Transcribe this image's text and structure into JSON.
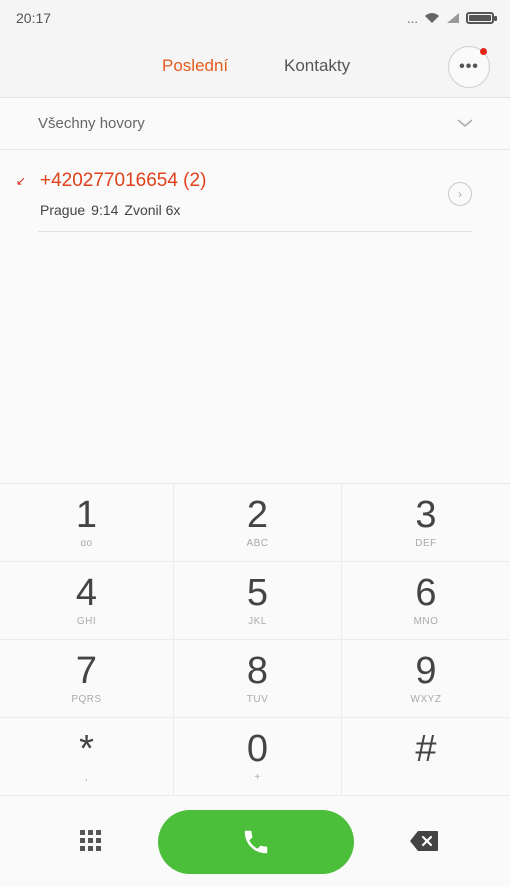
{
  "status_bar": {
    "time": "20:17",
    "signal_text": "..."
  },
  "header": {
    "tabs": [
      {
        "label": "Poslední",
        "active": true
      },
      {
        "label": "Kontakty",
        "active": false
      }
    ],
    "menu_icon": "more-icon",
    "notification_color": "#e0261b"
  },
  "filter": {
    "label": "Všechny hovory",
    "icon": "chevron-down-icon"
  },
  "calls": [
    {
      "number": "+420277016654 (2)",
      "location": "Prague",
      "time": "9:14",
      "status": "Zvonil 6x",
      "type": "missed"
    }
  ],
  "keypad": [
    {
      "digit": "1",
      "letters": "ɑo"
    },
    {
      "digit": "2",
      "letters": "ABC"
    },
    {
      "digit": "3",
      "letters": "DEF"
    },
    {
      "digit": "4",
      "letters": "GHI"
    },
    {
      "digit": "5",
      "letters": "JKL"
    },
    {
      "digit": "6",
      "letters": "MNO"
    },
    {
      "digit": "7",
      "letters": "PQRS"
    },
    {
      "digit": "8",
      "letters": "TUV"
    },
    {
      "digit": "9",
      "letters": "WXYZ"
    },
    {
      "digit": "*",
      "letters": ","
    },
    {
      "digit": "0",
      "letters": "+"
    },
    {
      "digit": "#",
      "letters": ""
    }
  ],
  "colors": {
    "accent": "#e55b1c",
    "missed": "#e0401b",
    "call_button": "#4cbf3a"
  }
}
